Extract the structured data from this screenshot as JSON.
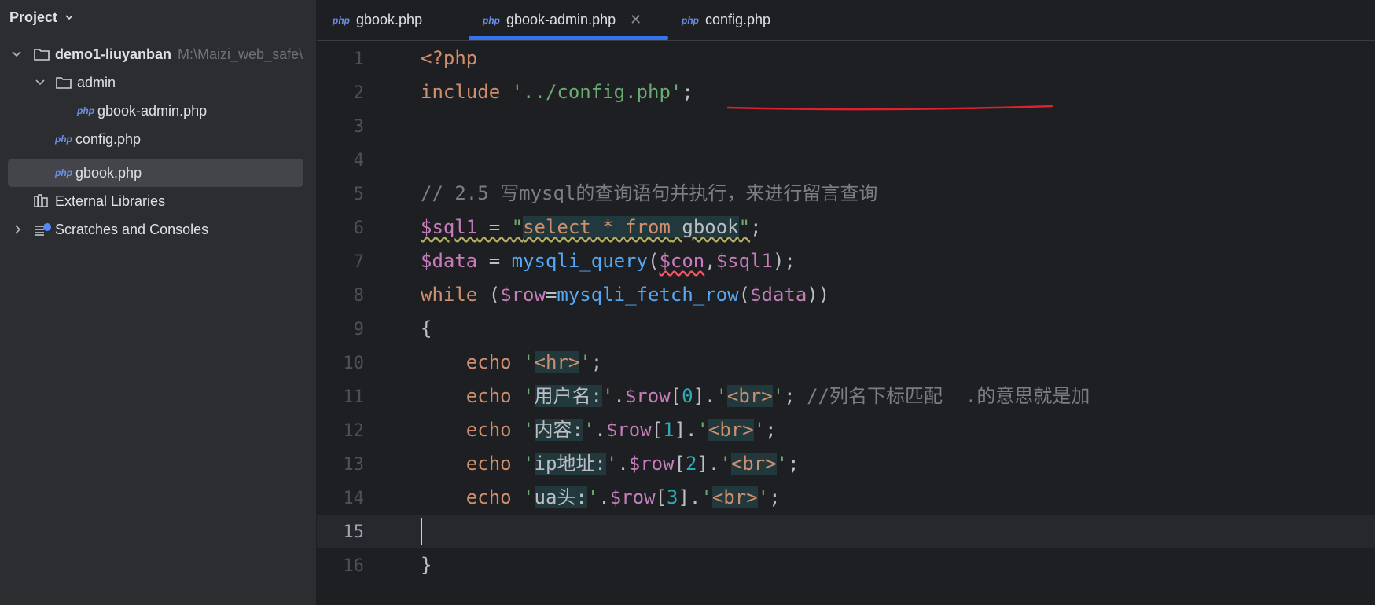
{
  "sidebar": {
    "title": "Project",
    "tree": [
      {
        "label": "demo1-liuyanban",
        "path": "M:\\Maizi_web_safe\\"
      },
      {
        "label": "admin"
      },
      {
        "label": "gbook-admin.php",
        "badge": "php"
      },
      {
        "label": "config.php",
        "badge": "php"
      },
      {
        "label": "gbook.php",
        "badge": "php"
      },
      {
        "label": "External Libraries"
      },
      {
        "label": "Scratches and Consoles"
      }
    ]
  },
  "tabs": [
    {
      "label": "gbook.php",
      "badge": "php"
    },
    {
      "label": "gbook-admin.php",
      "badge": "php",
      "active": true
    },
    {
      "label": "config.php",
      "badge": "php"
    }
  ],
  "editor": {
    "current_line": 15,
    "line_numbers": [
      "1",
      "2",
      "3",
      "4",
      "5",
      "6",
      "7",
      "8",
      "9",
      "10",
      "11",
      "12",
      "13",
      "14",
      "15",
      "16"
    ],
    "code": {
      "l1": "<?php",
      "l2_kw": "include",
      "l2_str": "'../config.php'",
      "l2_end": ";",
      "l5": "// 2.5 写mysql的查询语句并执行，来进行留言查询",
      "l6_var": "$sql1",
      "l6_eq": " = ",
      "l6_q1": "\"",
      "l6_sql_kw1": "select",
      "l6_star": " * ",
      "l6_sql_kw2": "from",
      "l6_tbl": " gbook",
      "l6_q2": "\"",
      "l6_end": ";",
      "l7_var": "$data",
      "l7_eq": " = ",
      "l7_fn": "mysqli_query",
      "l7_p1": "(",
      "l7_con": "$con",
      "l7_comma": ",",
      "l7_sql": "$sql1",
      "l7_end": ");",
      "l8_kw": "while",
      "l8_p": " (",
      "l8_row": "$row",
      "l8_eq": "=",
      "l8_fn": "mysqli_fetch_row",
      "l8_p2": "(",
      "l8_data": "$data",
      "l8_end": "))",
      "l9": "{",
      "echo": "echo",
      "q": "'",
      "hr": "<hr>",
      "br": "<br>",
      "semi": ";",
      "dot": ".",
      "row": "$row",
      "l11_text": "用户名:",
      "l11_idx": "0",
      "l11_comment": "//列名下标匹配  .的意思就是加",
      "l12_text": "内容:",
      "l12_idx": "1",
      "l13_text": "ip地址:",
      "l13_idx": "2",
      "l14_text": "ua头:",
      "l14_idx": "3",
      "l16": "}"
    }
  },
  "colors": {
    "keyword": "#cf8e6d",
    "string": "#6aab73",
    "variable": "#c77dbb",
    "function": "#56a8f5",
    "number": "#2aacb8",
    "comment": "#7a7e85",
    "annotation_red": "#e0202a",
    "accent": "#3574f0"
  }
}
